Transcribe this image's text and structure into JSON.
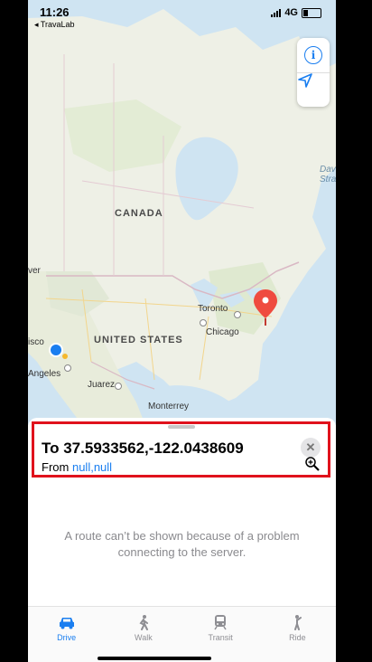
{
  "status_bar": {
    "time": "11:26",
    "back_app": "◂ TravaLab",
    "network": "4G"
  },
  "map": {
    "country_labels": [
      "CANADA",
      "UNITED STATES"
    ],
    "cities": [
      "Toronto",
      "Chicago",
      "Juarez",
      "Monterrey",
      "Angeles",
      "isco",
      "ver"
    ],
    "edge_label_line1": "Dav",
    "edge_label_line2": "Stra",
    "info_icon": "info-icon",
    "location_icon": "location-arrow-icon"
  },
  "route": {
    "to_text": "To 37.5933562,-122.0438609",
    "from_prefix": "From",
    "from_value": "null,null"
  },
  "message": "A route can’t be shown because of a problem connecting to the server.",
  "tabs": [
    {
      "label": "Drive",
      "icon": "car-icon",
      "active": true
    },
    {
      "label": "Walk",
      "icon": "walk-icon",
      "active": false
    },
    {
      "label": "Transit",
      "icon": "train-icon",
      "active": false
    },
    {
      "label": "Ride",
      "icon": "ride-icon",
      "active": false
    }
  ],
  "colors": {
    "accent": "#1a7ef0",
    "highlight_border": "#e0121c",
    "pin": "#ef4b3f"
  }
}
